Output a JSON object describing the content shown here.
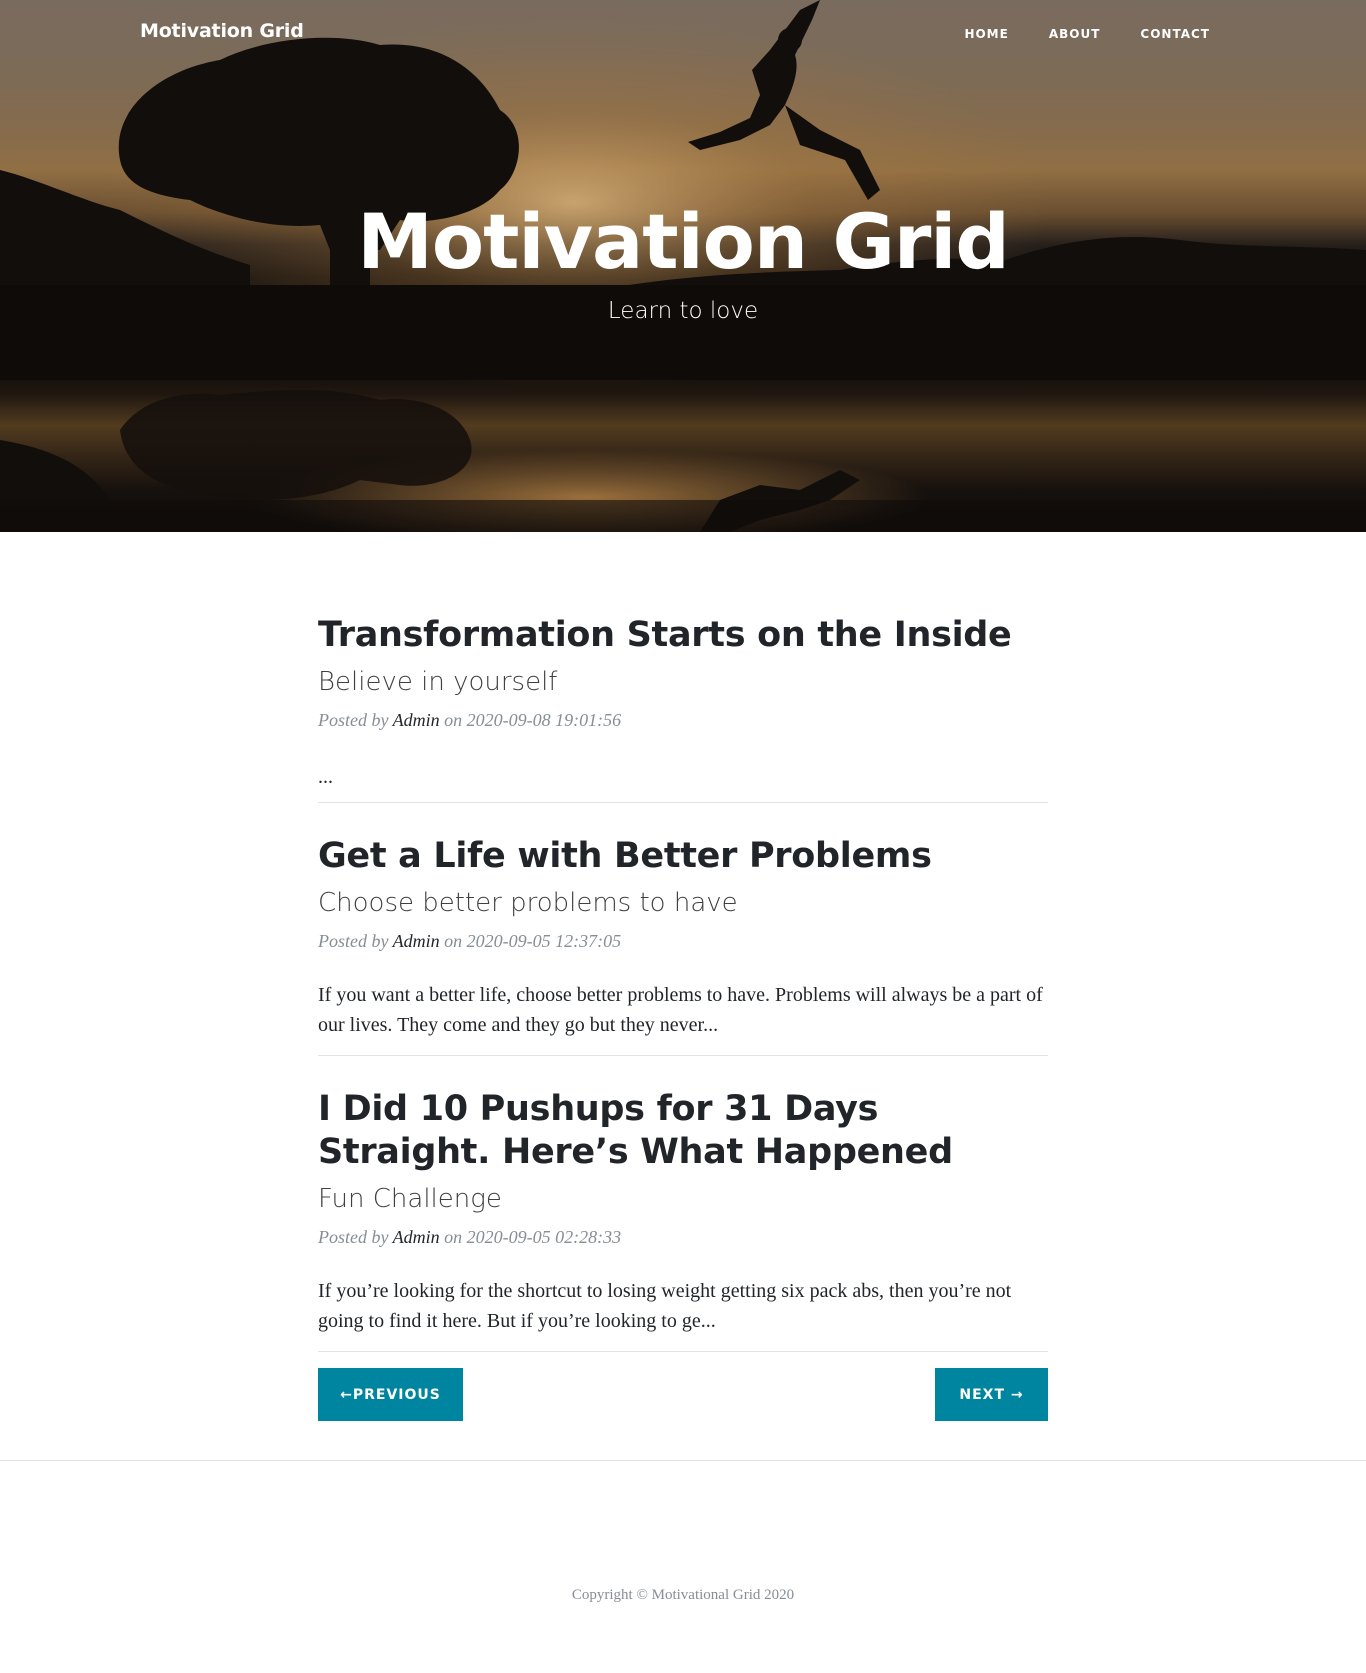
{
  "nav": {
    "brand": "Motivation Grid",
    "links": [
      "HOME",
      "ABOUT",
      "CONTACT"
    ]
  },
  "hero": {
    "title": "Motivation Grid",
    "subtitle": "Learn to love"
  },
  "posts": [
    {
      "title": "Transformation Starts on the Inside",
      "subtitle": "Believe in yourself",
      "meta_prefix": "Posted by",
      "author": "Admin",
      "meta_on": "on",
      "date": "2020-09-08 19:01:56",
      "excerpt": "..."
    },
    {
      "title": "Get a Life with Better Problems",
      "subtitle": "Choose better problems to have",
      "meta_prefix": "Posted by",
      "author": "Admin",
      "meta_on": "on",
      "date": "2020-09-05 12:37:05",
      "excerpt": "If you want a better life, choose better problems to have. Problems will always be a part of our lives. They come and they go but they never..."
    },
    {
      "title": "I Did 10 Pushups for 31 Days Straight. Here’s What Happened",
      "subtitle": "Fun Challenge",
      "meta_prefix": "Posted by",
      "author": "Admin",
      "meta_on": "on",
      "date": "2020-09-05 02:28:33",
      "excerpt": "If you’re looking for the shortcut to losing weight getting six pack abs, then you’re not going to find it here. But if you’re looking to ge..."
    }
  ],
  "pager": {
    "previous": "←PREVIOUS",
    "next": "NEXT →"
  },
  "footer": {
    "copyright": "Copyright © Motivational Grid 2020"
  },
  "colors": {
    "accent": "#0085a1",
    "meta": "#868e96",
    "heading": "#212529"
  }
}
